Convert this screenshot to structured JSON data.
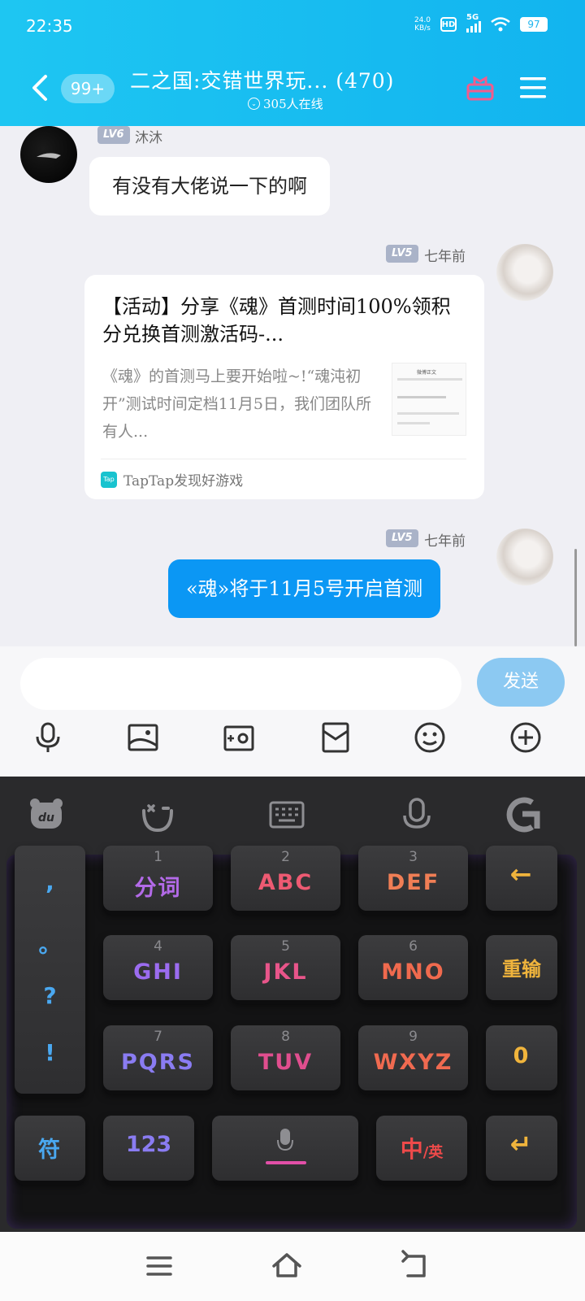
{
  "status": {
    "time": "22:35",
    "net_speed_value": "24.0",
    "net_speed_unit": "KB/s",
    "hd": "HD",
    "signal": "5G",
    "battery": "97"
  },
  "header": {
    "unread_badge": "99+",
    "title": "二之国:交错世界玩... (470)",
    "online": "305人在线"
  },
  "messages": [
    {
      "level": "LV6",
      "name": "沐沐",
      "text": "有没有大佬说一下的啊"
    },
    {
      "level": "LV5",
      "name": "七年前",
      "share": {
        "title": "【活动】分享《魂》首测时间100%领积分兑换首测激活码-...",
        "desc": "《魂》的首测马上要开始啦~!“魂沌初开”测试时间定档11月5日，我们团队所有人...",
        "thumb_title": "微博正文",
        "source_logo": "Tap",
        "source": "TapTap发现好游戏"
      }
    },
    {
      "level": "LV5",
      "name": "七年前",
      "text": "«魂»将于11月5号开启首测"
    }
  ],
  "input": {
    "placeholder": "",
    "send_label": "发送"
  },
  "keyboard": {
    "punct": [
      ",",
      "。",
      "?",
      "!"
    ],
    "keys": [
      {
        "num": "1",
        "label": "分词",
        "color": "#b36ae8"
      },
      {
        "num": "2",
        "label": "ABC",
        "color": "#ee5a72"
      },
      {
        "num": "3",
        "label": "DEF",
        "color": "#f07e55"
      },
      {
        "num": "4",
        "label": "GHI",
        "color": "#9b6cf0"
      },
      {
        "num": "5",
        "label": "JKL",
        "color": "#e8558a"
      },
      {
        "num": "6",
        "label": "MNO",
        "color": "#f06a4e"
      },
      {
        "num": "7",
        "label": "PQRS",
        "color": "#8a7cf2"
      },
      {
        "num": "8",
        "label": "TUV",
        "color": "#e04e8e"
      },
      {
        "num": "9",
        "label": "WXYZ",
        "color": "#f06a50"
      }
    ],
    "backspace": "←",
    "reinput": "重输",
    "zero": "0",
    "symbol": "符",
    "num123": "123",
    "lang_main": "中",
    "lang_alt": "/英",
    "enter": "↵",
    "colors": {
      "blue": "#4aa8f0",
      "yellow": "#f0b43c",
      "purple": "#8a7cf2",
      "red": "#ee4a4a"
    }
  }
}
